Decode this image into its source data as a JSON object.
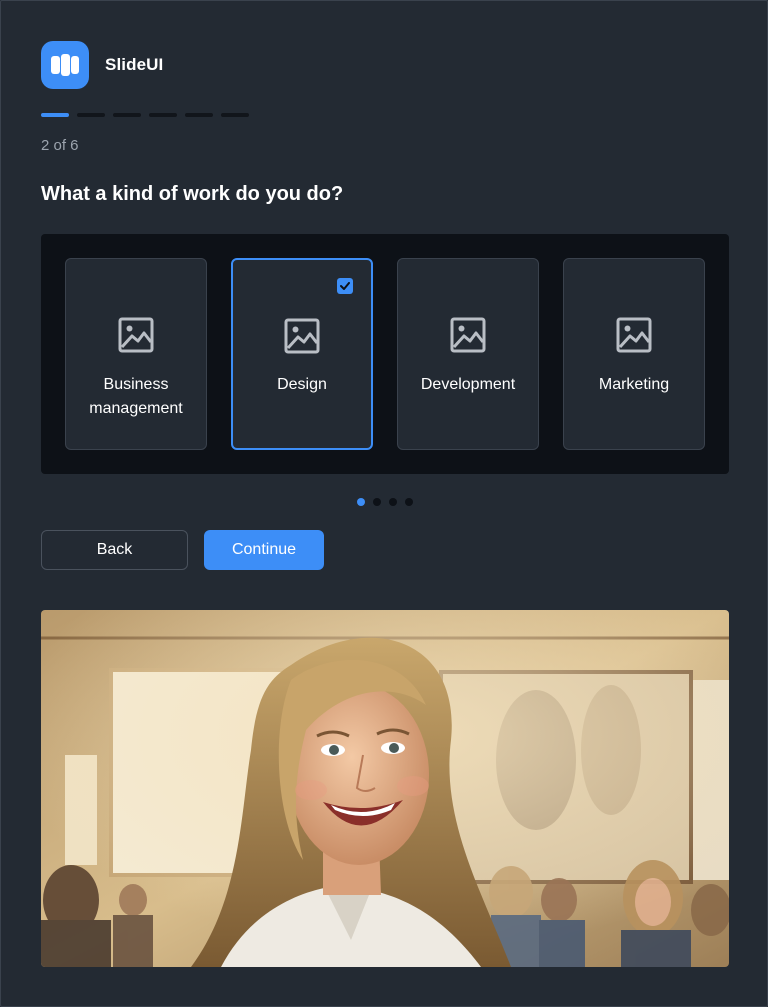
{
  "app": {
    "name": "SlideUI",
    "logo_icon": "app-logo-icon"
  },
  "progress": {
    "current_step": 2,
    "total_steps": 6,
    "label": "2 of 6"
  },
  "question": "What a kind of work do you do?",
  "options": [
    {
      "label": "Business management",
      "icon": "image-placeholder-icon",
      "selected": false
    },
    {
      "label": "Design",
      "icon": "image-placeholder-icon",
      "selected": true
    },
    {
      "label": "Development",
      "icon": "image-placeholder-icon",
      "selected": false
    },
    {
      "label": "Marketing",
      "icon": "image-placeholder-icon",
      "selected": false
    }
  ],
  "carousel": {
    "pages": 4,
    "active_page": 1
  },
  "buttons": {
    "back": "Back",
    "continue": "Continue"
  },
  "colors": {
    "accent": "#3d8ef7",
    "background": "#232a33",
    "panel": "#0d1117"
  }
}
